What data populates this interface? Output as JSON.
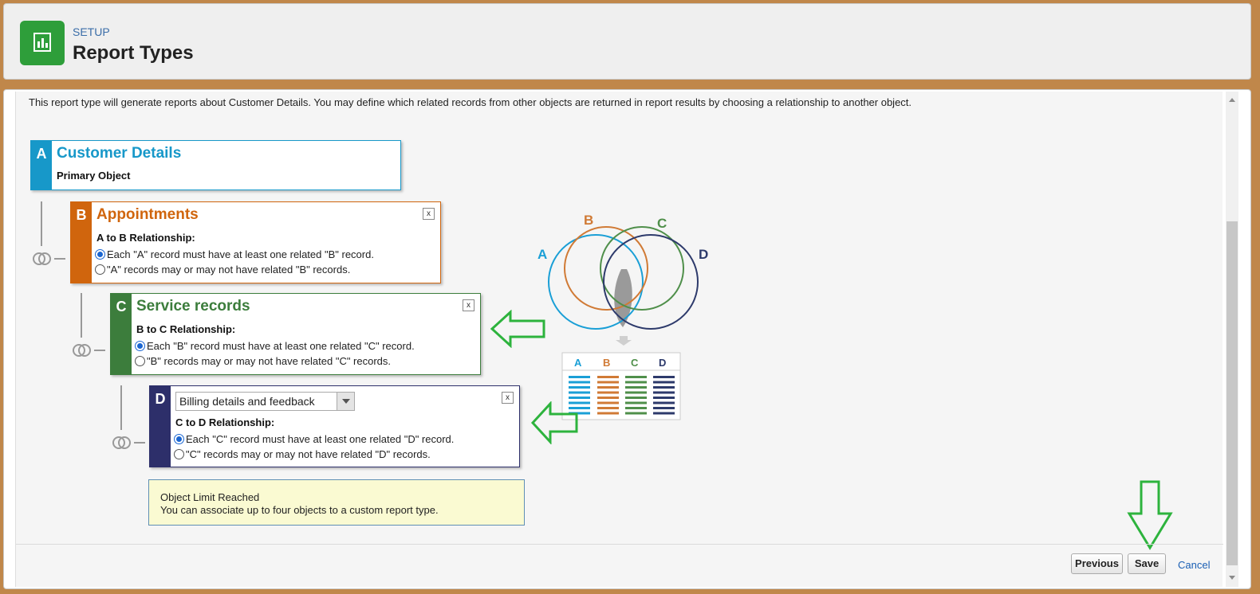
{
  "header": {
    "eyebrow": "SETUP",
    "title": "Report Types",
    "logo_icon": "report-chart-icon",
    "logo_color": "#2e9e3a"
  },
  "description": "This report type will generate reports about Customer Details. You may define which related records from other objects are returned in report results by choosing a relationship to another object.",
  "objects": [
    {
      "letter": "A",
      "name": "Customer Details",
      "role": "Primary Object",
      "color": "#1798c9"
    },
    {
      "letter": "B",
      "name": "Appointments",
      "relationship_label": "A to B Relationship:",
      "option_required": "Each \"A\" record must have at least one related \"B\" record.",
      "option_optional": "\"A\" records may or may not have related \"B\" records.",
      "selected": "required",
      "color": "#d0650d"
    },
    {
      "letter": "C",
      "name": "Service records",
      "relationship_label": "B to C Relationship:",
      "option_required": "Each \"B\" record must have at least one related \"C\" record.",
      "option_optional": "\"B\" records may or may not have related \"C\" records.",
      "selected": "required",
      "color": "#3c7d3c"
    },
    {
      "letter": "D",
      "select_value": "Billing details and feedback",
      "relationship_label": "C to D Relationship:",
      "option_required": "Each \"C\" record must have at least one related \"D\" record.",
      "option_optional": "\"C\" records may or may not have related \"D\" records.",
      "selected": "required",
      "color": "#2d2f6a"
    }
  ],
  "close_label": "x",
  "venn": {
    "labels": [
      "A",
      "B",
      "C",
      "D"
    ],
    "table_headers": [
      "A",
      "B",
      "C",
      "D"
    ],
    "colors": [
      "#1a9fd6",
      "#d07a35",
      "#4f8f4a",
      "#2d3a6b"
    ]
  },
  "limit_notice": {
    "title": "Object Limit Reached",
    "message": "You can associate up to four objects to a custom report type."
  },
  "footer": {
    "previous_label": "Previous",
    "save_label": "Save",
    "cancel_label": "Cancel"
  },
  "annotation_color": "#2db33d"
}
